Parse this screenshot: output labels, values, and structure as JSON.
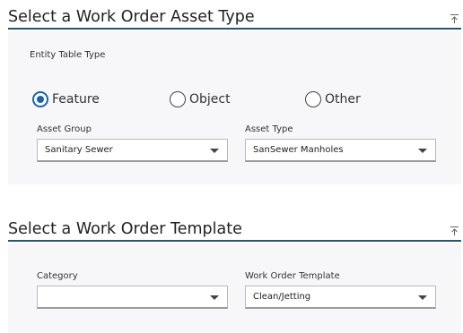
{
  "asset_type_section": {
    "title": "Select a Work Order Asset Type",
    "entity_table_type_label": "Entity Table Type",
    "radios": [
      {
        "label": "Feature",
        "checked": true
      },
      {
        "label": "Object",
        "checked": false
      },
      {
        "label": "Other",
        "checked": false
      }
    ],
    "asset_group": {
      "label": "Asset Group",
      "value": "Sanitary Sewer"
    },
    "asset_type": {
      "label": "Asset Type",
      "value": "SanSewer Manholes"
    }
  },
  "template_section": {
    "title": "Select a Work Order Template",
    "category": {
      "label": "Category",
      "value": ""
    },
    "work_order_template": {
      "label": "Work Order Template",
      "value": "Clean/Jetting"
    }
  },
  "icons": {
    "collapse": "collapse-up-icon",
    "dropdown": "chevron-down-icon",
    "radio": "radio-button"
  },
  "colors": {
    "accent": "#1d63a4",
    "header_rule": "#26566e",
    "panel_bg": "#f7f7f9"
  }
}
